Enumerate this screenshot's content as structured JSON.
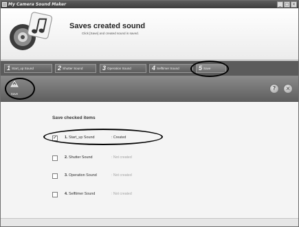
{
  "window": {
    "title": "My Camera Sound Maker"
  },
  "header": {
    "title": "Saves created sound",
    "subtitle": "Click [Save] and created sound is saved."
  },
  "tabs": [
    {
      "num": "1",
      "label": "Start_up Sound"
    },
    {
      "num": "2",
      "label": "Shutter Sound"
    },
    {
      "num": "3",
      "label": "Operation Sound"
    },
    {
      "num": "4",
      "label": "Selftimer Sound"
    },
    {
      "num": "5",
      "label": "Save"
    }
  ],
  "toolbar": {
    "save_label": "Save",
    "help_glyph": "?",
    "close_glyph": "×"
  },
  "main": {
    "section_title": "Save checked items",
    "items": [
      {
        "num": "1.",
        "name": "Start_up Sound",
        "status": ": Created",
        "checked": true,
        "check": "✓"
      },
      {
        "num": "2.",
        "name": "Shutter Sound",
        "status": ": Not created",
        "checked": false,
        "check": ""
      },
      {
        "num": "3.",
        "name": "Operation Sound",
        "status": ": Not created",
        "checked": false,
        "check": ""
      },
      {
        "num": "4.",
        "name": "Selftimer Sound",
        "status": ": Not created",
        "checked": false,
        "check": ""
      }
    ]
  },
  "colors": {
    "title_bar": "#4a4a4a",
    "tab_bar": "#5b5b5b",
    "toolbar": "#767676",
    "highlight_ring": "#000000"
  },
  "icons": [
    "app-icon",
    "minimize-icon",
    "maximize-icon",
    "close-icon",
    "speaker-music-note-icon",
    "save-icon",
    "help-icon",
    "close-circle-icon"
  ]
}
